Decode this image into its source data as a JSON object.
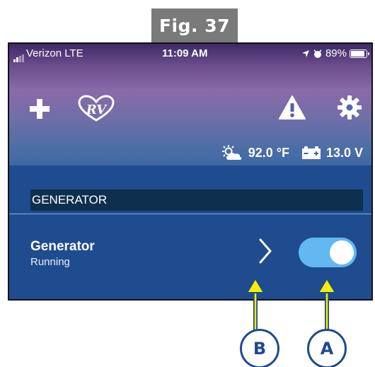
{
  "figure": {
    "label": "Fig. 37"
  },
  "status_bar": {
    "carrier": "Verizon  LTE",
    "time": "11:09 AM",
    "battery": "89%",
    "battery_level": 0.89
  },
  "header": {
    "icons": [
      "plus-icon",
      "rv-heart-logo",
      "warning-icon",
      "gear-icon"
    ],
    "temperature": "92.0 °F",
    "voltage": "13.0 V"
  },
  "section": {
    "title": "GENERATOR"
  },
  "generator_row": {
    "title": "Generator",
    "status": "Running",
    "toggle_on": true
  },
  "callouts": {
    "b": "B",
    "a": "A"
  },
  "colors": {
    "app_blue": "#1f4c8f",
    "section_dark": "#0f2f4f",
    "toggle_on": "#63b8f2",
    "callout_yellow": "#f5f000",
    "callout_blue": "#1d4a8f",
    "fig_gray": "#7a7a7a"
  }
}
